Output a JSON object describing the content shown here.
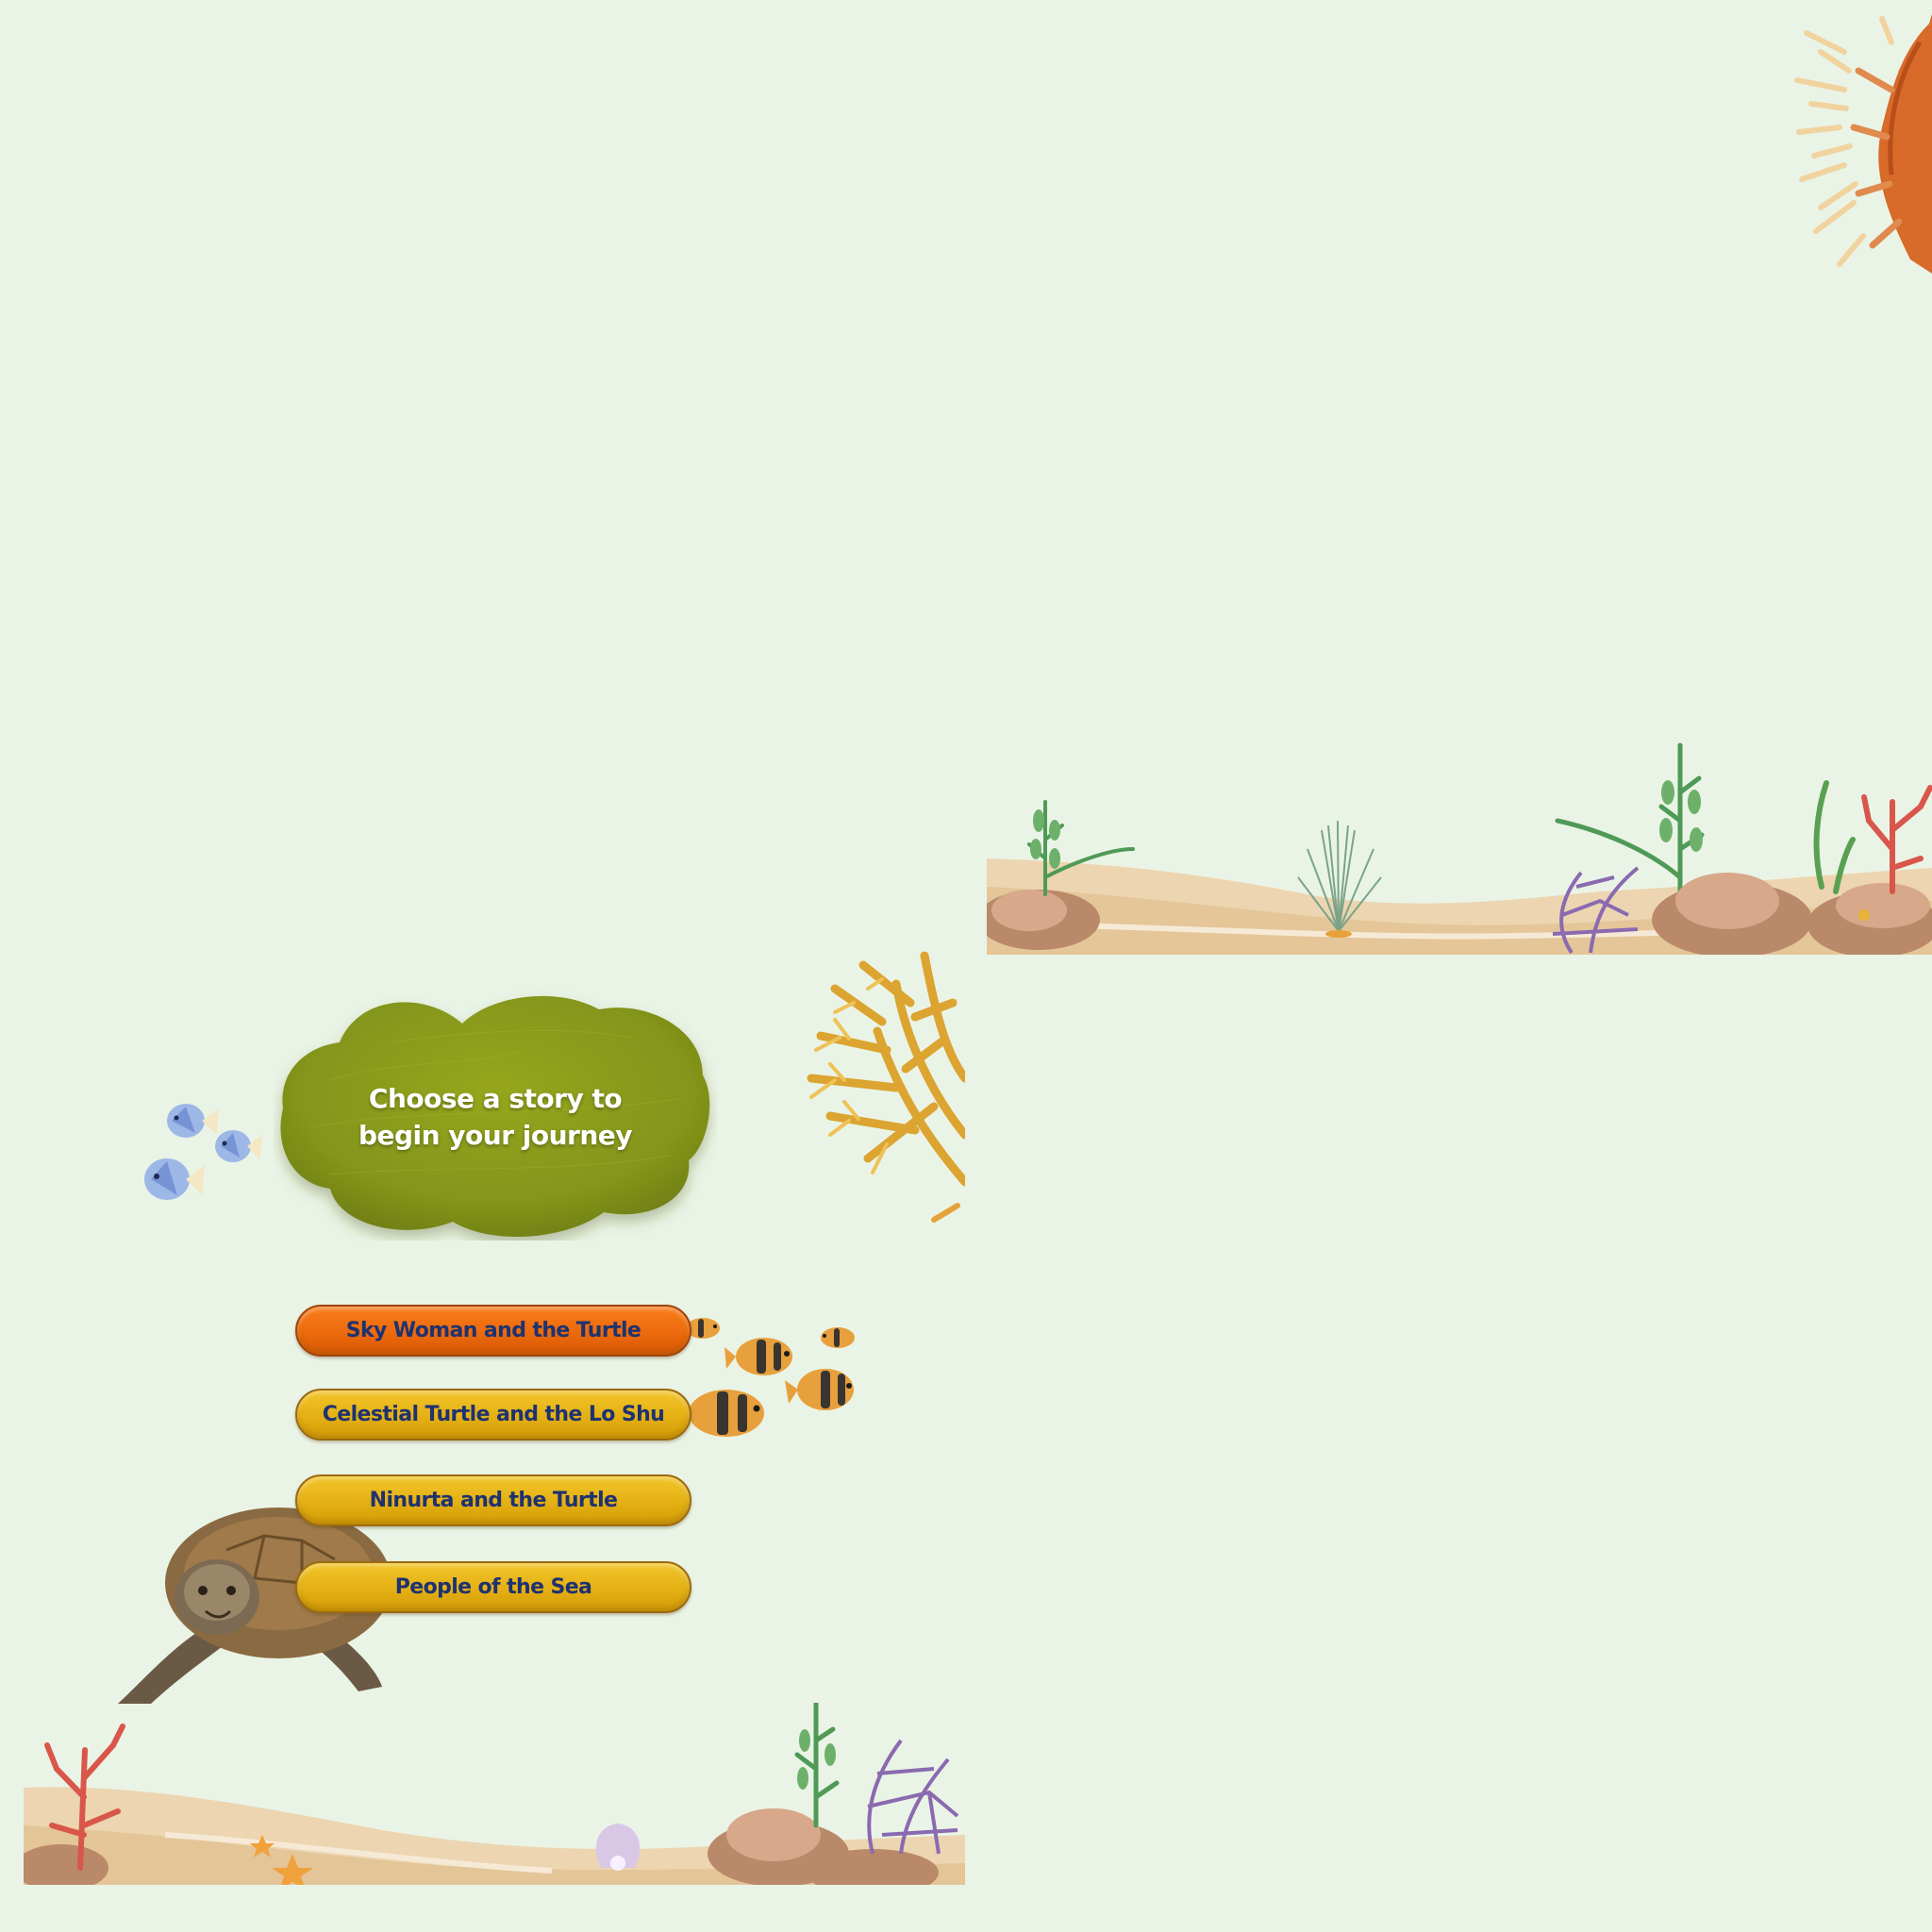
{
  "title": "Choose a story to\nbegin your journey",
  "stories": [
    {
      "label": "Sky Woman and the Turtle",
      "selected": true
    },
    {
      "label": "Celestial Turtle and the Lo Shu",
      "selected": false
    },
    {
      "label": "Ninurta and the Turtle",
      "selected": false
    },
    {
      "label": "People of the Sea",
      "selected": false
    }
  ],
  "colors": {
    "background": "#eaf4e6",
    "button_gold": "#e4b013",
    "button_orange": "#ec6a0c",
    "button_text": "#1e3270",
    "cloud_green": "#8a9a1c"
  },
  "decorations": [
    "coral-branch-topright",
    "seabed-strip-upper",
    "yellow-coral",
    "blue-fish-school",
    "clownfish-school",
    "sea-turtle",
    "seabed-strip-lower",
    "starfish",
    "pearl-shell"
  ]
}
